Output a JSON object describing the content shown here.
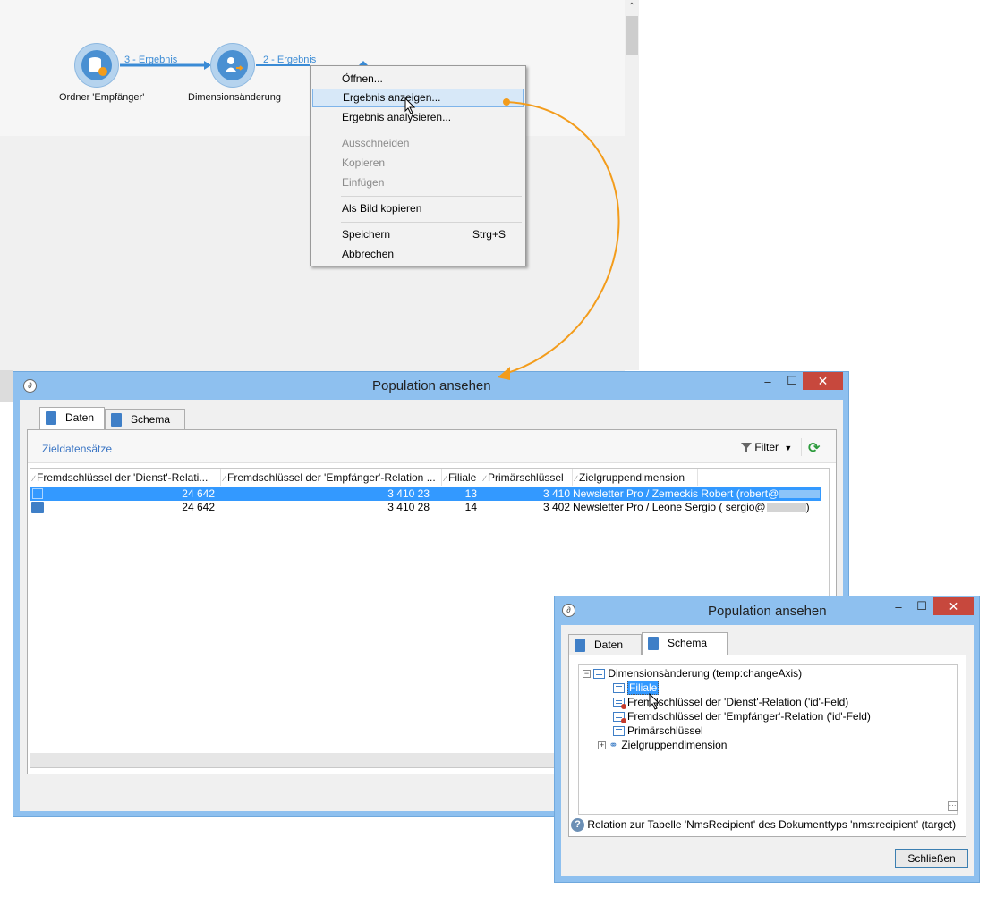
{
  "workflow": {
    "nodes": [
      {
        "label": "Ordner 'Empfänger'"
      },
      {
        "label": "Dimensionsänderung"
      }
    ],
    "edges": [
      {
        "label": "3 - Ergebnis"
      },
      {
        "label": "2 - Ergebnis"
      }
    ]
  },
  "context_menu": {
    "items": [
      {
        "label": "Öffnen...",
        "enabled": true
      },
      {
        "label": "Ergebnis anzeigen...",
        "enabled": true,
        "highlighted": true
      },
      {
        "label": "Ergebnis analysieren...",
        "enabled": true
      },
      {
        "label": "Ausschneiden",
        "enabled": false
      },
      {
        "label": "Kopieren",
        "enabled": false
      },
      {
        "label": "Einfügen",
        "enabled": false
      },
      {
        "label": "Als Bild kopieren",
        "enabled": true
      },
      {
        "label": "Speichern",
        "enabled": true,
        "shortcut": "Strg+S"
      },
      {
        "label": "Abbrechen",
        "enabled": true
      }
    ]
  },
  "main_window": {
    "title": "Population ansehen",
    "controls": {
      "minimize": "–",
      "maximize": "☐",
      "close": "✕"
    },
    "tabs": [
      {
        "label": "Daten",
        "active": true
      },
      {
        "label": "Schema",
        "active": false
      }
    ],
    "section_title": "Zieldatensätze",
    "filter_label": "Filter",
    "columns": [
      "Fremdschlüssel der 'Dienst'-Relati...",
      "Fremdschlüssel der 'Empfänger'-Relation ...",
      "Filiale",
      "Primärschlüssel",
      "Zielgruppendimension"
    ],
    "rows": [
      {
        "dienst": "24 642",
        "empfaenger": "3 410 23",
        "filiale": "13",
        "primaer": "3 410",
        "ziel": "Newsletter Pro / Zemeckis Robert (robert@",
        "selected": true
      },
      {
        "dienst": "24 642",
        "empfaenger": "3 410 28",
        "filiale": "14",
        "primaer": "3 402",
        "ziel": "Newsletter Pro / Leone Sergio ( sergio@",
        "ziel_end": ")",
        "selected": false
      }
    ]
  },
  "schema_window": {
    "title": "Population ansehen",
    "controls": {
      "minimize": "–",
      "maximize": "☐",
      "close": "✕"
    },
    "tabs": [
      {
        "label": "Daten",
        "active": false
      },
      {
        "label": "Schema",
        "active": true
      }
    ],
    "tree": {
      "root": "Dimensionsänderung (temp:changeAxis)",
      "children": [
        {
          "label": "Filiale",
          "selected": true
        },
        {
          "label": "Fremdschlüssel der 'Dienst'-Relation ('id'-Feld)"
        },
        {
          "label": "Fremdschlüssel der 'Empfänger'-Relation ('id'-Feld)"
        },
        {
          "label": "Primärschlüssel"
        },
        {
          "label": "Zielgruppendimension",
          "expandable": true
        }
      ]
    },
    "info_text": "Relation zur Tabelle 'NmsRecipient' des Dokumenttyps 'nms:recipient' (target)",
    "close_button": "Schließen"
  },
  "colors": {
    "accent": "#3399ff",
    "title_bar": "#8ec0ef",
    "close_red": "#c7483d",
    "annotation_arrow": "#f39c1b",
    "link_blue": "#3a8bd5"
  }
}
